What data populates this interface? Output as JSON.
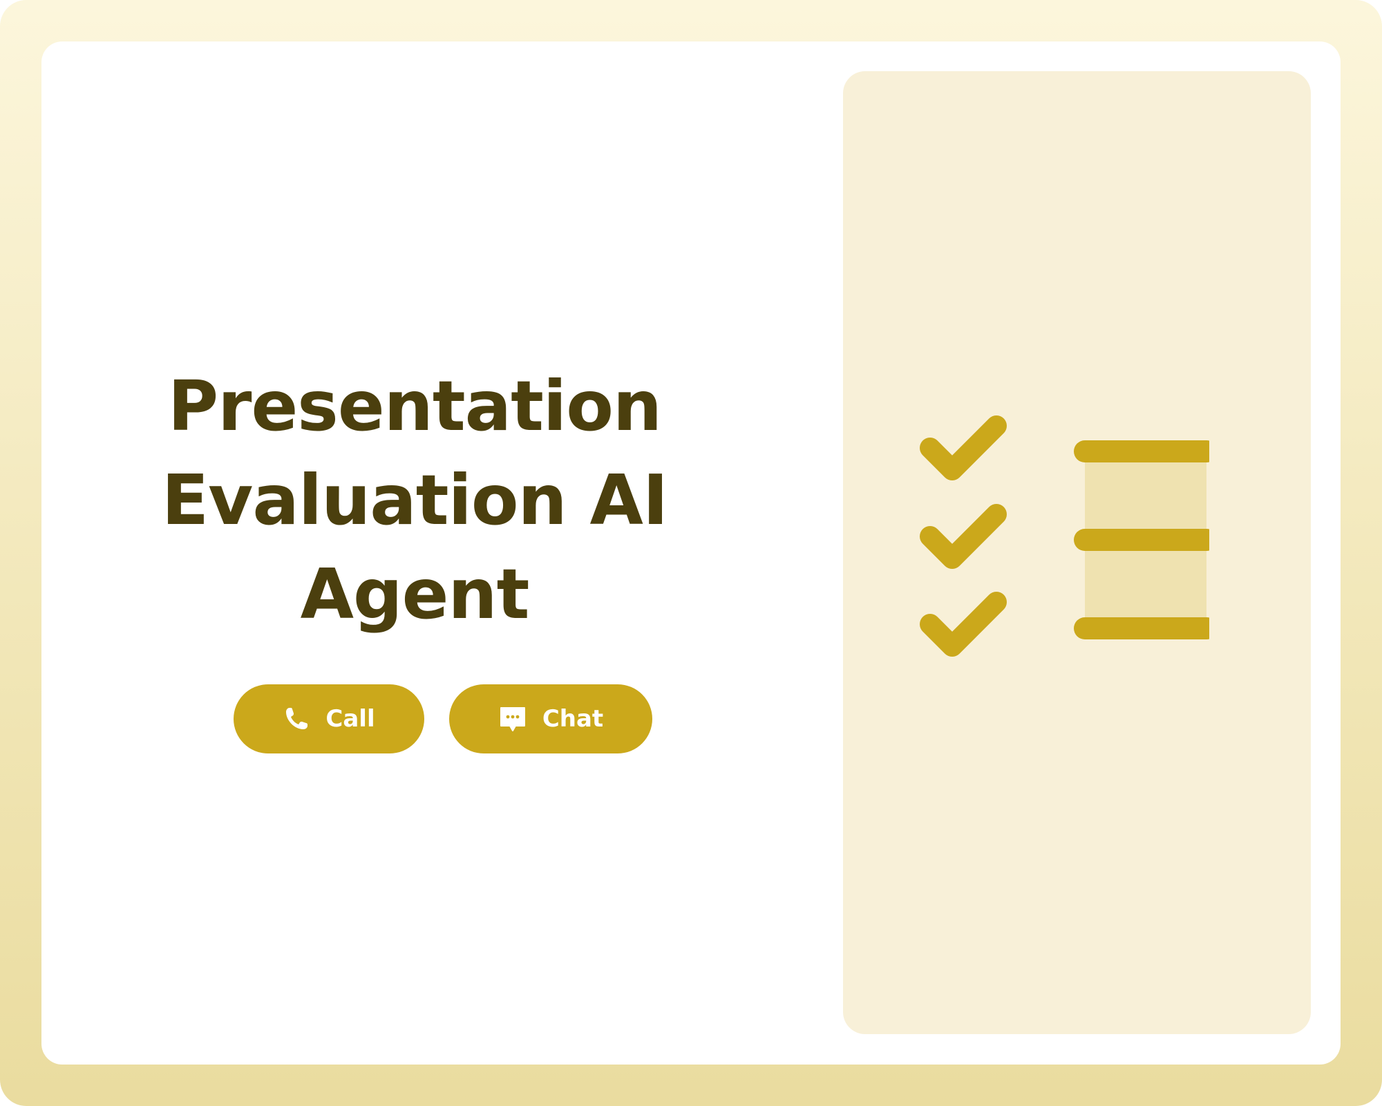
{
  "hero": {
    "title": "Presentation Evaluation AI Agent"
  },
  "actions": {
    "call_label": "Call",
    "chat_label": "Chat"
  },
  "colors": {
    "accent": "#cba81b",
    "title_text": "#4b3f0e",
    "panel_bg": "#f8f0d8",
    "frame_bg": "#f3e8b8",
    "card_bg": "#ffffff"
  },
  "icons": {
    "call": "phone-icon",
    "chat": "chat-bubble-icon",
    "illustration": "checklist-icon"
  }
}
